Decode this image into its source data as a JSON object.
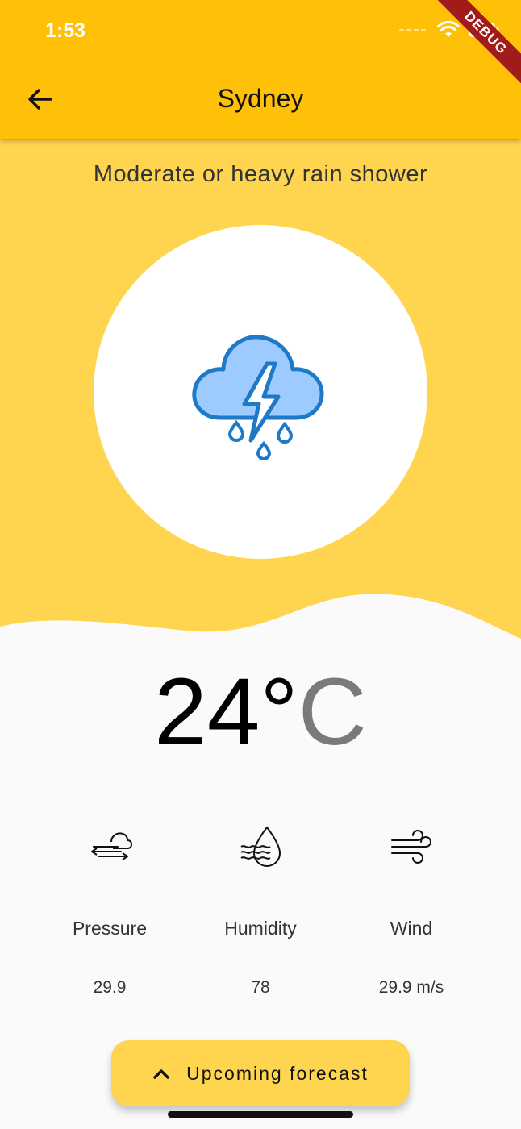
{
  "status_bar": {
    "time": "1:53"
  },
  "debug_banner": "DEBUG",
  "app_bar": {
    "title": "Sydney",
    "back_icon": "arrow-left-icon"
  },
  "weather": {
    "condition": "Moderate or heavy rain shower",
    "icon": "thunderstorm-rain-cloud-icon",
    "temperature": "24°",
    "unit": "C"
  },
  "metrics": [
    {
      "label": "Pressure",
      "value": "29.9",
      "icon": "pressure-icon"
    },
    {
      "label": "Humidity",
      "value": "78",
      "icon": "humidity-icon"
    },
    {
      "label": "Wind",
      "value": "29.9 m/s",
      "icon": "wind-icon"
    }
  ],
  "forecast_button": {
    "label": "Upcoming forecast",
    "icon": "chevron-up-icon"
  },
  "colors": {
    "app_bar": "#ffc107",
    "hero_background": "#ffd54f",
    "page_background": "#fafafa",
    "cloud_fill": "#9ecbff",
    "cloud_stroke": "#1e7ac8"
  }
}
